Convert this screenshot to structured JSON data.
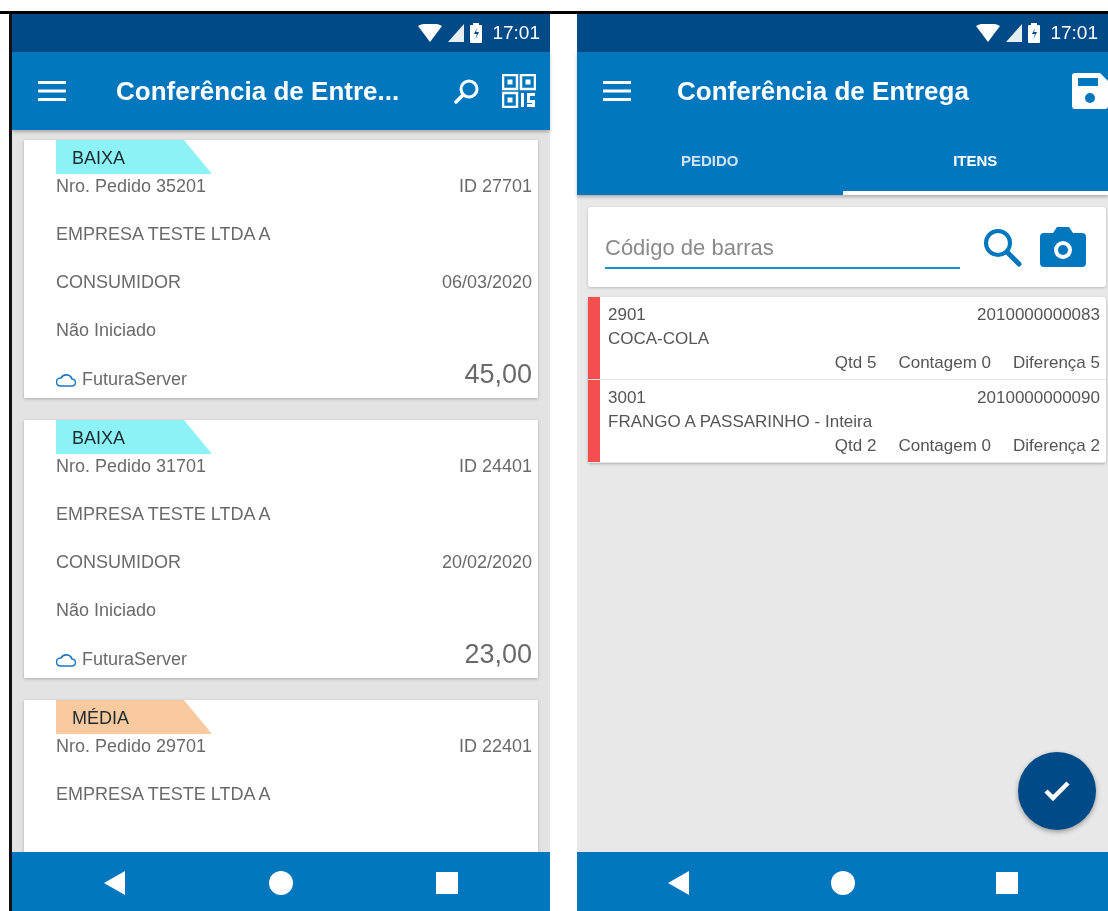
{
  "left_screen": {
    "status_time": "17:01",
    "title": "Conferência de Entre...",
    "cards": [
      {
        "tag": {
          "label": "BAIXA",
          "color": "#8cf2f5"
        },
        "order": "Nro. Pedido 35201",
        "id": "ID 27701",
        "company": "EMPRESA TESTE LTDA A",
        "customer": "CONSUMIDOR",
        "date": "06/03/2020",
        "status": "Não Iniciado",
        "server": "FuturaServer",
        "total": "45,00"
      },
      {
        "tag": {
          "label": "BAIXA",
          "color": "#8cf2f5"
        },
        "order": "Nro. Pedido 31701",
        "id": "ID 24401",
        "company": "EMPRESA TESTE LTDA A",
        "customer": "CONSUMIDOR",
        "date": "20/02/2020",
        "status": "Não Iniciado",
        "server": "FuturaServer",
        "total": "23,00"
      },
      {
        "tag": {
          "label": "MÉDIA",
          "color": "#f9c9a0"
        },
        "order": "Nro. Pedido 29701",
        "id": "ID 22401",
        "company": "EMPRESA TESTE LTDA A"
      }
    ]
  },
  "right_screen": {
    "status_time": "17:01",
    "title": "Conferência de Entrega",
    "tabs": [
      {
        "label": "PEDIDO",
        "selected": false
      },
      {
        "label": "ITENS",
        "selected": true
      }
    ],
    "search": {
      "placeholder": "Código de barras"
    },
    "items": [
      {
        "code": "2901",
        "barcode": "2010000000083",
        "name": "COCA-COLA",
        "qty": "Qtd 5",
        "count": "Contagem 0",
        "difference": "Diferença 5",
        "color": "#f44f4f"
      },
      {
        "code": "3001",
        "barcode": "2010000000090",
        "name": "FRANGO A PASSARINHO - Inteira",
        "qty": "Qtd 2",
        "count": "Contagem 0",
        "difference": "Diferença 2",
        "color": "#f44f4f"
      }
    ]
  }
}
